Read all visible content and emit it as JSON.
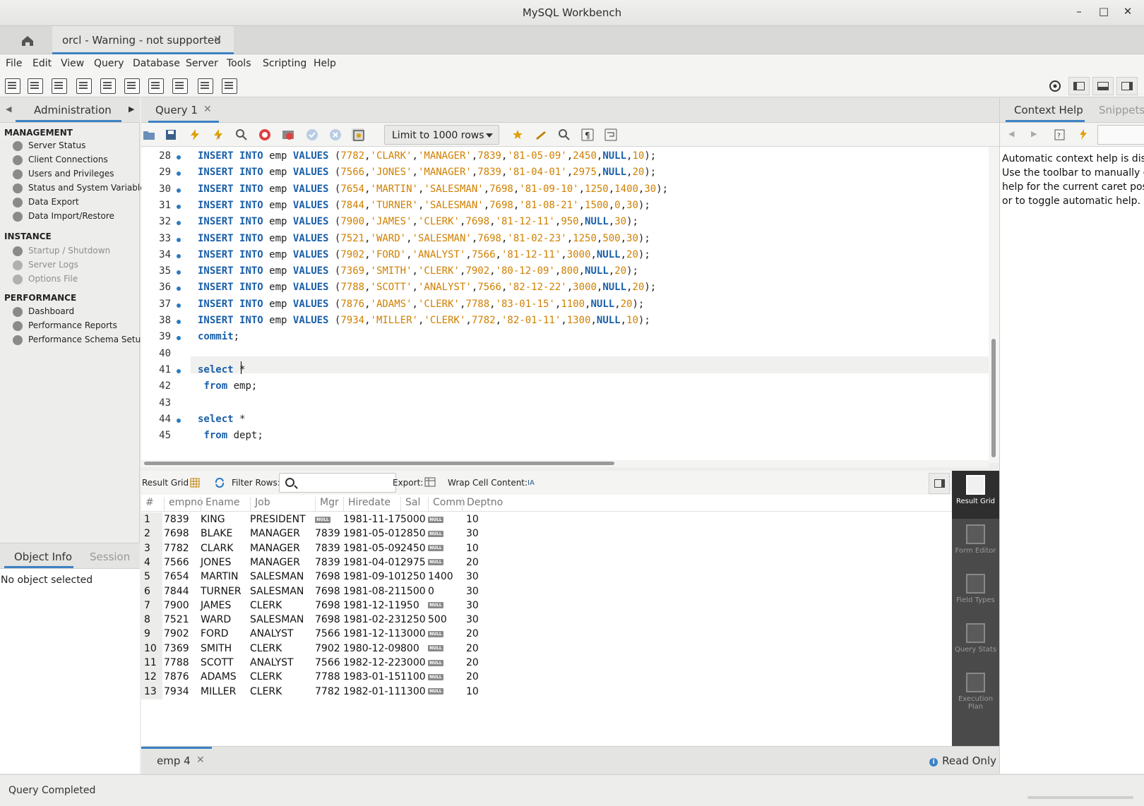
{
  "window": {
    "title": "MySQL Workbench",
    "min": "–",
    "max": "□",
    "close": "✕"
  },
  "connection_tab": {
    "label": "orcl - Warning - not supported",
    "close": "✕"
  },
  "menu": [
    "File",
    "Edit",
    "View",
    "Query",
    "Database",
    "Server",
    "Tools",
    "Scripting",
    "Help"
  ],
  "sidebar": {
    "header": "Administration",
    "sections": [
      {
        "title": "MANAGEMENT",
        "items": [
          {
            "label": "Server Status",
            "disabled": false
          },
          {
            "label": "Client Connections",
            "disabled": false
          },
          {
            "label": "Users and Privileges",
            "disabled": false
          },
          {
            "label": "Status and System Variables",
            "disabled": false
          },
          {
            "label": "Data Export",
            "disabled": false
          },
          {
            "label": "Data Import/Restore",
            "disabled": false
          }
        ]
      },
      {
        "title": "INSTANCE",
        "items": [
          {
            "label": "Startup / Shutdown",
            "disabled": true
          },
          {
            "label": "Server Logs",
            "disabled": true
          },
          {
            "label": "Options File",
            "disabled": true
          }
        ]
      },
      {
        "title": "PERFORMANCE",
        "items": [
          {
            "label": "Dashboard",
            "disabled": false
          },
          {
            "label": "Performance Reports",
            "disabled": false
          },
          {
            "label": "Performance Schema Setup",
            "disabled": false
          }
        ]
      }
    ]
  },
  "object_info": {
    "tab1": "Object Info",
    "tab2": "Session",
    "message": "No object selected"
  },
  "query_tab": {
    "label": "Query 1",
    "close": "✕"
  },
  "editor_toolbar": {
    "limit": "Limit to 1000 rows"
  },
  "editor": {
    "lines": [
      {
        "n": "28",
        "dot": true,
        "code": "INSERT INTO emp VALUES (7782,'CLARK','MANAGER',7839,'81-05-09',2450,NULL,10);"
      },
      {
        "n": "29",
        "dot": true,
        "code": "INSERT INTO emp VALUES (7566,'JONES','MANAGER',7839,'81-04-01',2975,NULL,20);"
      },
      {
        "n": "30",
        "dot": true,
        "code": "INSERT INTO emp VALUES (7654,'MARTIN','SALESMAN',7698,'81-09-10',1250,1400,30);"
      },
      {
        "n": "31",
        "dot": true,
        "code": "INSERT INTO emp VALUES (7844,'TURNER','SALESMAN',7698,'81-08-21',1500,0,30);"
      },
      {
        "n": "32",
        "dot": true,
        "code": "INSERT INTO emp VALUES (7900,'JAMES','CLERK',7698,'81-12-11',950,NULL,30);"
      },
      {
        "n": "33",
        "dot": true,
        "code": "INSERT INTO emp VALUES (7521,'WARD','SALESMAN',7698,'81-02-23',1250,500,30);"
      },
      {
        "n": "34",
        "dot": true,
        "code": "INSERT INTO emp VALUES (7902,'FORD','ANALYST',7566,'81-12-11',3000,NULL,20);"
      },
      {
        "n": "35",
        "dot": true,
        "code": "INSERT INTO emp VALUES (7369,'SMITH','CLERK',7902,'80-12-09',800,NULL,20);"
      },
      {
        "n": "36",
        "dot": true,
        "code": "INSERT INTO emp VALUES (7788,'SCOTT','ANALYST',7566,'82-12-22',3000,NULL,20);"
      },
      {
        "n": "37",
        "dot": true,
        "code": "INSERT INTO emp VALUES (7876,'ADAMS','CLERK',7788,'83-01-15',1100,NULL,20);"
      },
      {
        "n": "38",
        "dot": true,
        "code": "INSERT INTO emp VALUES (7934,'MILLER','CLERK',7782,'82-01-11',1300,NULL,10);"
      },
      {
        "n": "39",
        "dot": true,
        "code": "commit;"
      },
      {
        "n": "40",
        "dot": false,
        "code": ""
      },
      {
        "n": "41",
        "dot": true,
        "code": "select *"
      },
      {
        "n": "42",
        "dot": false,
        "code": " from emp;"
      },
      {
        "n": "43",
        "dot": false,
        "code": ""
      },
      {
        "n": "44",
        "dot": true,
        "code": "select *"
      },
      {
        "n": "45",
        "dot": false,
        "code": " from dept;"
      }
    ]
  },
  "result_toolbar": {
    "result_grid": "Result Grid",
    "filter_rows": "Filter Rows:",
    "export": "Export:",
    "wrap": "Wrap Cell Content:",
    "filter_value": ""
  },
  "grid": {
    "columns": [
      "#",
      "empno",
      "Ename",
      "Job",
      "Mgr",
      "Hiredate",
      "Sal",
      "Comm",
      "Deptno"
    ],
    "rows": [
      [
        "1",
        "7839",
        "KING",
        "PRESIDENT",
        "NULL",
        "1981-11-17",
        "5000",
        "NULL",
        "10"
      ],
      [
        "2",
        "7698",
        "BLAKE",
        "MANAGER",
        "7839",
        "1981-05-01",
        "2850",
        "NULL",
        "30"
      ],
      [
        "3",
        "7782",
        "CLARK",
        "MANAGER",
        "7839",
        "1981-05-09",
        "2450",
        "NULL",
        "10"
      ],
      [
        "4",
        "7566",
        "JONES",
        "MANAGER",
        "7839",
        "1981-04-01",
        "2975",
        "NULL",
        "20"
      ],
      [
        "5",
        "7654",
        "MARTIN",
        "SALESMAN",
        "7698",
        "1981-09-10",
        "1250",
        "1400",
        "30"
      ],
      [
        "6",
        "7844",
        "TURNER",
        "SALESMAN",
        "7698",
        "1981-08-21",
        "1500",
        "0",
        "30"
      ],
      [
        "7",
        "7900",
        "JAMES",
        "CLERK",
        "7698",
        "1981-12-11",
        "950",
        "NULL",
        "30"
      ],
      [
        "8",
        "7521",
        "WARD",
        "SALESMAN",
        "7698",
        "1981-02-23",
        "1250",
        "500",
        "30"
      ],
      [
        "9",
        "7902",
        "FORD",
        "ANALYST",
        "7566",
        "1981-12-11",
        "3000",
        "NULL",
        "20"
      ],
      [
        "10",
        "7369",
        "SMITH",
        "CLERK",
        "7902",
        "1980-12-09",
        "800",
        "NULL",
        "20"
      ],
      [
        "11",
        "7788",
        "SCOTT",
        "ANALYST",
        "7566",
        "1982-12-22",
        "3000",
        "NULL",
        "20"
      ],
      [
        "12",
        "7876",
        "ADAMS",
        "CLERK",
        "7788",
        "1983-01-15",
        "1100",
        "NULL",
        "20"
      ],
      [
        "13",
        "7934",
        "MILLER",
        "CLERK",
        "7782",
        "1982-01-11",
        "1300",
        "NULL",
        "10"
      ]
    ]
  },
  "result_strip": [
    {
      "label": "Result Grid",
      "active": true
    },
    {
      "label": "Form Editor",
      "active": false
    },
    {
      "label": "Field Types",
      "active": false
    },
    {
      "label": "Query Stats",
      "active": false
    },
    {
      "label": "Execution Plan",
      "active": false
    }
  ],
  "bottom_tab": {
    "label": "emp 4",
    "close": "✕",
    "read_only": "Read Only"
  },
  "context_help": {
    "tab1": "Context Help",
    "tab2": "Snippets",
    "text": "Automatic context help is disabled. Use the toolbar to manually get help for the current caret position or to toggle automatic help."
  },
  "status": {
    "text": "Query Completed"
  },
  "colors": {
    "accent": "#3d82c4",
    "keyword": "#1a5fa8",
    "literal": "#d08000"
  }
}
